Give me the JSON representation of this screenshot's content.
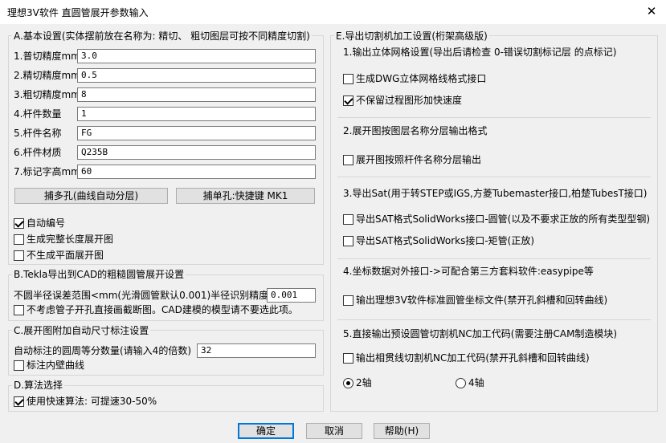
{
  "window": {
    "title": "理想3V软件 直圆管展开参数输入",
    "close_glyph": "✕"
  },
  "groupA": {
    "title": "A.基本设置(实体摆前放在名称为: 精切、 粗切图层可按不同精度切割)",
    "fields": [
      {
        "label": "1.普切精度mm",
        "value": "3.0"
      },
      {
        "label": "2.精切精度mm",
        "value": "0.5"
      },
      {
        "label": "3.粗切精度mm",
        "value": "8"
      },
      {
        "label": "4.杆件数量",
        "value": "1"
      },
      {
        "label": "5.杆件名称",
        "value": "FG"
      },
      {
        "label": "6.杆件材质",
        "value": "Q235B"
      },
      {
        "label": "7.标记字高mm",
        "value": "60"
      }
    ],
    "btn_multi": "捕多孔(曲线自动分层)",
    "btn_single": "捕单孔:快捷键 MK1",
    "checks": [
      {
        "label": "自动编号",
        "checked": true
      },
      {
        "label": "生成完整长度展开图",
        "checked": false
      },
      {
        "label": "不生成平面展开图",
        "checked": false
      }
    ]
  },
  "groupB": {
    "title": "B.Tekla导出到CAD的粗糙圆管展开设置",
    "tol_label": "不圆半径误差范围<mm(光滑圆管默认0.001)半径识别精度:",
    "tol_value": "0.001",
    "check_label": "不考虑管子开孔直接画截断图。CAD建模的模型请不要选此项。",
    "checked": false
  },
  "groupC": {
    "title": "C.展开图附加自动尺寸标注设置",
    "div_label": "自动标注的圆周等分数量(请输入4的倍数)",
    "div_value": "32",
    "check_label": "标注内壁曲线",
    "checked": false
  },
  "groupD": {
    "title": "D.算法选择",
    "check_label": "使用快速算法: 可提速30-50%",
    "checked": true
  },
  "groupE": {
    "title": "E.导出切割机加工设置(桁架高级版)",
    "s1_title": "1.输出立体网格设置(导出后请检查 0-错误切割标记层 的点标记)",
    "s1_checks": [
      {
        "label": "生成DWG立体网格线格式接口",
        "checked": false
      },
      {
        "label": "不保留过程图形加快速度",
        "checked": true
      }
    ],
    "s2_title": "2.展开图按图层名称分层输出格式",
    "s2_check": {
      "label": "展开图按照杆件名称分层输出",
      "checked": false
    },
    "s3_title": "3.导出Sat(用于转STEP或IGS,方菱Tubemaster接口,柏楚TubesT接口)",
    "s3_checks": [
      {
        "label": "导出SAT格式SolidWorks接口-圆管(以及不要求正放的所有类型型钢)",
        "checked": false
      },
      {
        "label": "导出SAT格式SolidWorks接口-矩管(正放)",
        "checked": false
      }
    ],
    "s4_title": "4.坐标数据对外接口->可配合第三方套料软件:easypipe等",
    "s4_check": {
      "label": "输出理想3V软件标准圆管坐标文件(禁开孔斜槽和回转曲线)",
      "checked": false
    },
    "s5_title": "5.直接输出预设圆管切割机NC加工代码(需要注册CAM制造模块)",
    "s5_check": {
      "label": "输出相贯线切割机NC加工代码(禁开孔斜槽和回转曲线)",
      "checked": false
    },
    "radio_2": {
      "label": "2轴",
      "selected": true
    },
    "radio_4": {
      "label": "4轴",
      "selected": false
    }
  },
  "footer": {
    "ok": "确定",
    "cancel": "取消",
    "help": "帮助(H)"
  }
}
